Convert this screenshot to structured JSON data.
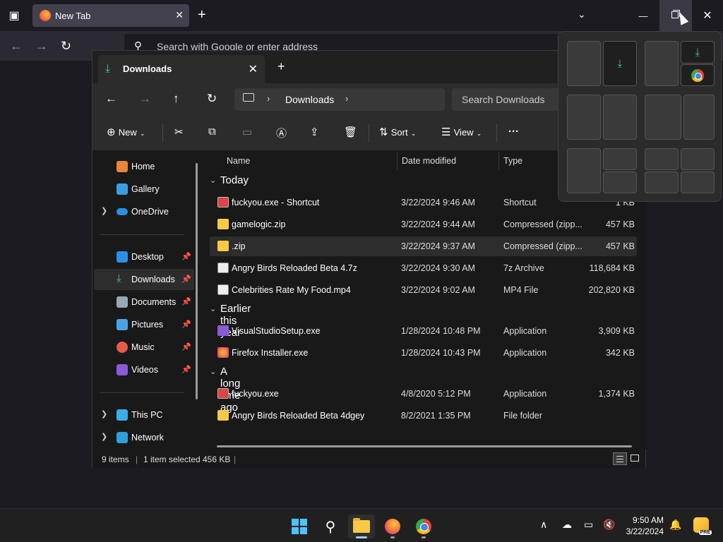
{
  "firefox": {
    "tab_title": "New Tab",
    "url_placeholder": "Search with Google or enter address"
  },
  "explorer": {
    "tab_title": "Downloads",
    "breadcrumb": "Downloads",
    "search_placeholder": "Search Downloads",
    "toolbar": {
      "new_label": "New",
      "sort_label": "Sort",
      "view_label": "View",
      "more_label": "···"
    },
    "sidebar": {
      "items": [
        {
          "label": "Home"
        },
        {
          "label": "Gallery"
        },
        {
          "label": "OneDrive"
        },
        {
          "label": "Desktop"
        },
        {
          "label": "Downloads"
        },
        {
          "label": "Documents"
        },
        {
          "label": "Pictures"
        },
        {
          "label": "Music"
        },
        {
          "label": "Videos"
        },
        {
          "label": "This PC"
        },
        {
          "label": "Network"
        }
      ]
    },
    "columns": {
      "name": "Name",
      "date": "Date modified",
      "type": "Type"
    },
    "groups": [
      {
        "label": "Today"
      },
      {
        "label": "Earlier this year"
      },
      {
        "label": "A long time ago"
      }
    ],
    "files": [
      {
        "name": "fuckyou.exe - Shortcut",
        "date": "3/22/2024 9:46 AM",
        "type": "Shortcut",
        "size": "1 KB"
      },
      {
        "name": "gamelogic.zip",
        "date": "3/22/2024 9:44 AM",
        "type": "Compressed (zipp...",
        "size": "457 KB"
      },
      {
        "name": ".zip",
        "date": "3/22/2024 9:37 AM",
        "type": "Compressed (zipp...",
        "size": "457 KB"
      },
      {
        "name": "Angry Birds Reloaded Beta 4.7z",
        "date": "3/22/2024 9:30 AM",
        "type": "7z Archive",
        "size": "118,684 KB"
      },
      {
        "name": "Celebrities Rate My Food.mp4",
        "date": "3/22/2024 9:02 AM",
        "type": "MP4 File",
        "size": "202,820 KB"
      },
      {
        "name": "VisualStudioSetup.exe",
        "date": "1/28/2024 10:48 PM",
        "type": "Application",
        "size": "3,909 KB"
      },
      {
        "name": "Firefox Installer.exe",
        "date": "1/28/2024 10:43 PM",
        "type": "Application",
        "size": "342 KB"
      },
      {
        "name": "fuckyou.exe",
        "date": "4/8/2020 5:12 PM",
        "type": "Application",
        "size": "1,374 KB"
      },
      {
        "name": "Angry Birds Reloaded Beta 4dgey",
        "date": "8/2/2021 1:35 PM",
        "type": "File folder",
        "size": ""
      }
    ],
    "status": {
      "items": "9 items",
      "selected": "1 item selected",
      "size": "456 KB"
    }
  },
  "taskbar": {
    "time": "9:50 AM",
    "date": "3/22/2024",
    "copilot_badge": "PRE"
  },
  "colors": {
    "accent": "#4cc2ff",
    "download_green": "#4cc2a3",
    "folder_yellow": "#f8c945"
  }
}
